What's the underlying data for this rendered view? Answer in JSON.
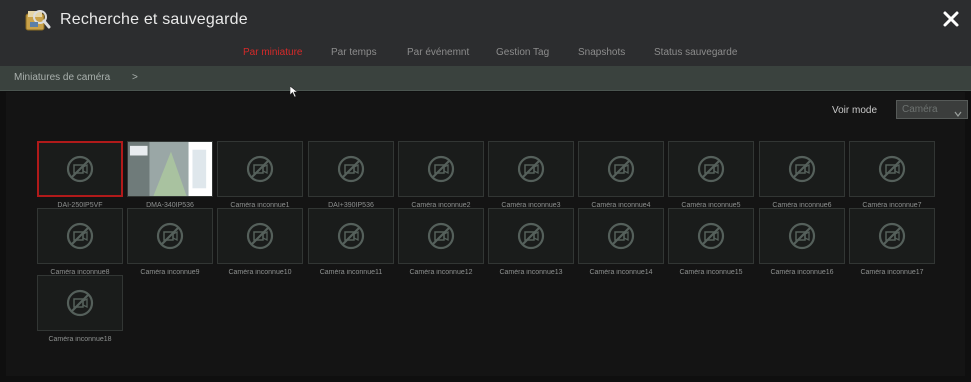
{
  "window": {
    "title": "Recherche et sauvegarde",
    "app_icon": "search-backup-icon",
    "close_icon": "close-icon"
  },
  "tabs": [
    {
      "label": "Par miniature",
      "active": true
    },
    {
      "label": "Par temps",
      "active": false
    },
    {
      "label": "Par événemnt",
      "active": false
    },
    {
      "label": "Gestion Tag",
      "active": false
    },
    {
      "label": "Snapshots",
      "active": false
    },
    {
      "label": "Status sauvegarde",
      "active": false
    }
  ],
  "breadcrumb": {
    "label": "Miniatures de caméra",
    "arrow": ">"
  },
  "view_mode": {
    "label": "Voir mode",
    "value": "Caméra",
    "icon": "chevron-down-icon"
  },
  "cameras": [
    {
      "name": "DAI-250IP5VF",
      "selected": true,
      "has_image": false
    },
    {
      "name": "DMA-340IP536",
      "selected": false,
      "has_image": true
    },
    {
      "name": "Caméra inconnue1",
      "selected": false,
      "has_image": false
    },
    {
      "name": "DAI+390IP536",
      "selected": false,
      "has_image": false
    },
    {
      "name": "Caméra inconnue2",
      "selected": false,
      "has_image": false
    },
    {
      "name": "Caméra inconnue3",
      "selected": false,
      "has_image": false
    },
    {
      "name": "Caméra inconnue4",
      "selected": false,
      "has_image": false
    },
    {
      "name": "Caméra inconnue5",
      "selected": false,
      "has_image": false
    },
    {
      "name": "Caméra inconnue6",
      "selected": false,
      "has_image": false
    },
    {
      "name": "Caméra inconnue7",
      "selected": false,
      "has_image": false
    },
    {
      "name": "Caméra inconnue8",
      "selected": false,
      "has_image": false
    },
    {
      "name": "Caméra inconnue9",
      "selected": false,
      "has_image": false
    },
    {
      "name": "Caméra inconnue10",
      "selected": false,
      "has_image": false
    },
    {
      "name": "Caméra inconnue11",
      "selected": false,
      "has_image": false
    },
    {
      "name": "Caméra inconnue12",
      "selected": false,
      "has_image": false
    },
    {
      "name": "Caméra inconnue13",
      "selected": false,
      "has_image": false
    },
    {
      "name": "Caméra inconnue14",
      "selected": false,
      "has_image": false
    },
    {
      "name": "Caméra inconnue15",
      "selected": false,
      "has_image": false
    },
    {
      "name": "Caméra inconnue16",
      "selected": false,
      "has_image": false
    },
    {
      "name": "Caméra inconnue17",
      "selected": false,
      "has_image": false
    },
    {
      "name": "Caméra inconnue18",
      "selected": false,
      "has_image": false
    }
  ],
  "colors": {
    "accent": "#d42a2a",
    "selected_border": "#b11a1a",
    "background": "#0f0f0f"
  }
}
